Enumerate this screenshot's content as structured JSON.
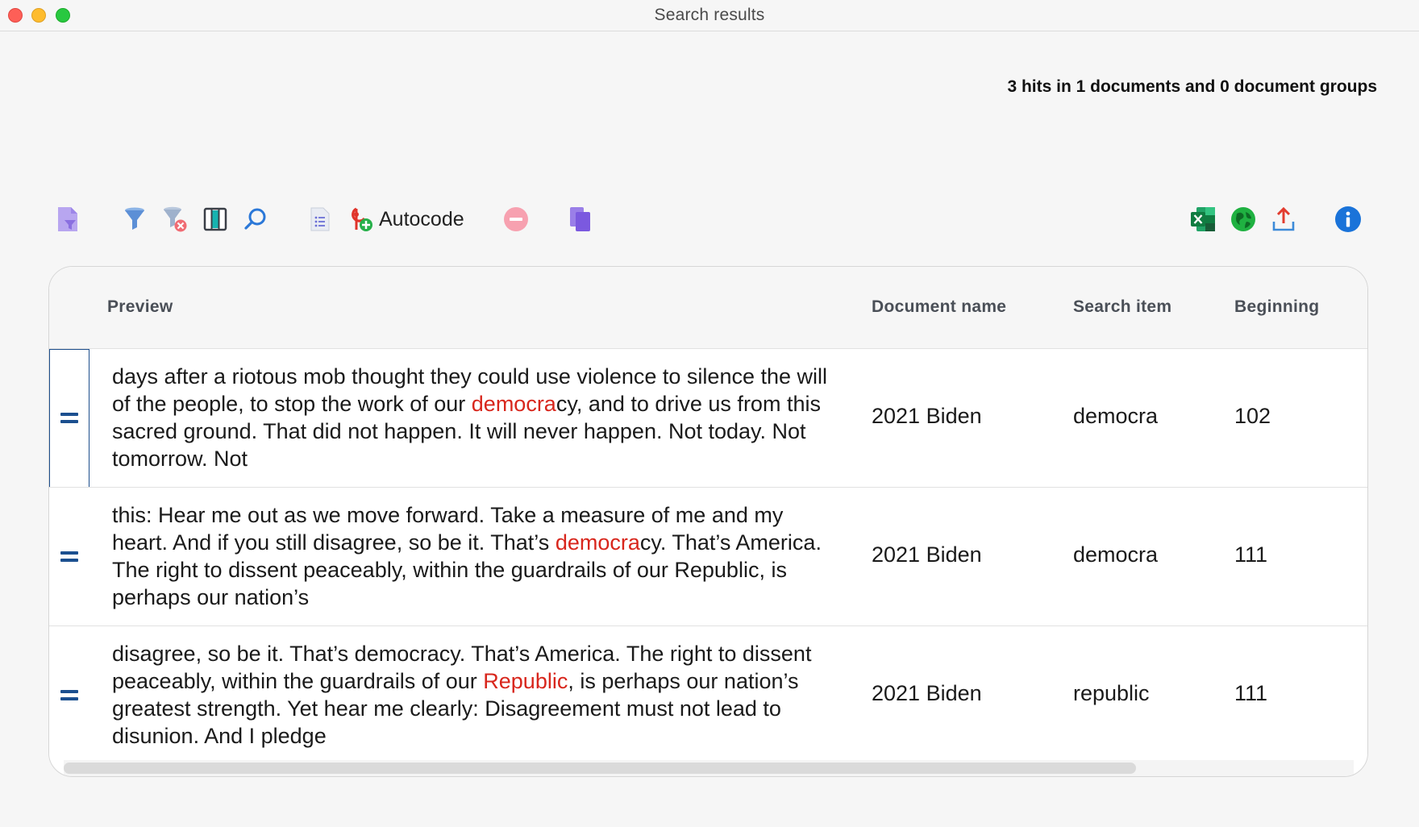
{
  "window": {
    "title": "Search results",
    "summary": "3 hits in 1 documents and 0 document groups"
  },
  "toolbar": {
    "autocode_label": "Autocode",
    "icons": [
      "document-filter-icon",
      "filter-icon",
      "clear-filter-icon",
      "columns-icon",
      "search-icon",
      "list-document-icon",
      "autocode-icon",
      "remove-icon",
      "copy-documents-icon",
      "excel-export-icon",
      "web-export-icon",
      "export-icon",
      "info-icon"
    ]
  },
  "table": {
    "headers": {
      "preview": "Preview",
      "document_name": "Document name",
      "search_item": "Search item",
      "beginning": "Beginning"
    },
    "rows": [
      {
        "preview_before": " days after a riotous mob thought they could use violence to silence the will of the people, to stop the work of our ",
        "preview_hit": "democra",
        "preview_after": "cy, and to drive us from this sacred ground.  That did not happen.  It will never happen.  Not today.  Not tomorrow.  Not",
        "document_name": "2021 Biden",
        "search_item": "democra",
        "beginning": "102",
        "selected": true
      },
      {
        "preview_before": " this: Hear me out as we move forward. Take a measure of me and my heart.  And if you still disagree, so be it.  That’s ",
        "preview_hit": "democra",
        "preview_after": "cy. That’s America. The right to dissent peaceably, within the guardrails of our Republic, is perhaps our nation’s",
        "document_name": "2021 Biden",
        "search_item": "democra",
        "beginning": "111",
        "selected": false
      },
      {
        "preview_before": " disagree, so be it.  That’s democracy. That’s America. The right to dissent peaceably, within the guardrails of our ",
        "preview_hit": "Republic",
        "preview_after": ", is perhaps our nation’s greatest strength.  Yet hear me clearly: Disagreement must not lead to disunion.  And I pledge",
        "document_name": "2021 Biden",
        "search_item": "republic",
        "beginning": "111",
        "selected": false
      }
    ]
  },
  "colors": {
    "highlight": "#d8261c",
    "handle": "#1b4f8f",
    "info": "#1a73d9"
  }
}
